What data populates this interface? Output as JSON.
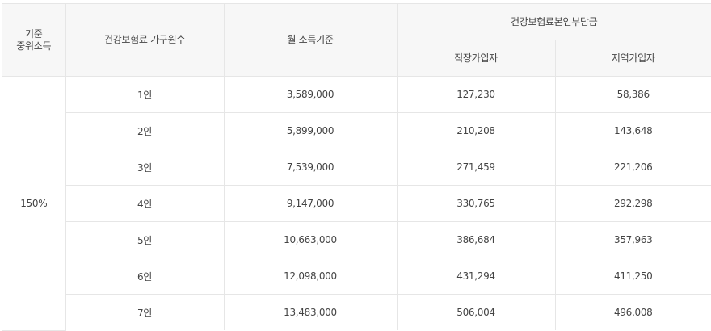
{
  "header": {
    "median_income_line1": "기준",
    "median_income_line2": "중위소득",
    "household_count": "건강보험료 가구원수",
    "monthly_income": "월 소득기준",
    "premium_group": "건강보험료본인부담금",
    "employee": "직장가입자",
    "regional": "지역가입자"
  },
  "percent": "150%",
  "rows": [
    {
      "household": "1인",
      "income": "3,589,000",
      "employee": "127,230",
      "regional": "58,386"
    },
    {
      "household": "2인",
      "income": "5,899,000",
      "employee": "210,208",
      "regional": "143,648"
    },
    {
      "household": "3인",
      "income": "7,539,000",
      "employee": "271,459",
      "regional": "221,206"
    },
    {
      "household": "4인",
      "income": "9,147,000",
      "employee": "330,765",
      "regional": "292,298"
    },
    {
      "household": "5인",
      "income": "10,663,000",
      "employee": "386,684",
      "regional": "357,963"
    },
    {
      "household": "6인",
      "income": "12,098,000",
      "employee": "431,294",
      "regional": "411,250"
    },
    {
      "household": "7인",
      "income": "13,483,000",
      "employee": "506,004",
      "regional": "496,008"
    }
  ]
}
